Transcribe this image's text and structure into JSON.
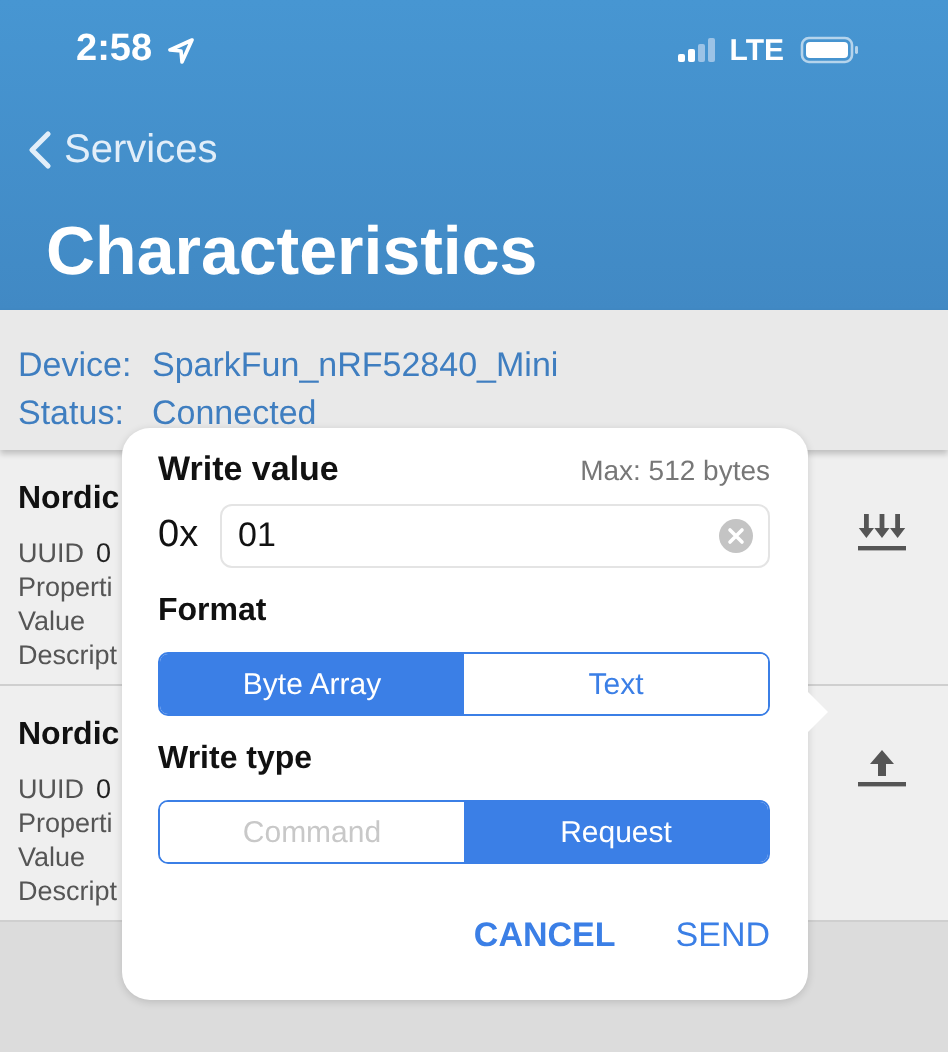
{
  "status_bar": {
    "time": "2:58",
    "network": "LTE"
  },
  "nav": {
    "back": "Services",
    "title": "Characteristics"
  },
  "device": {
    "device_label": "Device:",
    "device": "SparkFun_nRF52840_Mini",
    "status_label": "Status:",
    "status": "Connected"
  },
  "characteristics": [
    {
      "name": "Nordic",
      "uuid_label": "UUID",
      "uuid": "0",
      "properties_label": "Properti",
      "value_label": "Value",
      "descriptor_label": "Descript",
      "kind": "notify"
    },
    {
      "name": "Nordic",
      "uuid_label": "UUID",
      "uuid": "0",
      "properties_label": "Properti",
      "value_label": "Value",
      "descriptor_label": "Descript",
      "kind": "write"
    }
  ],
  "dialog": {
    "title": "Write value",
    "max": "Max: 512 bytes",
    "prefix": "0x",
    "value": "01",
    "format_label": "Format",
    "format_options": [
      {
        "label": "Byte Array",
        "selected": true,
        "disabled": false
      },
      {
        "label": "Text",
        "selected": false,
        "disabled": false
      }
    ],
    "write_type_label": "Write type",
    "write_type_options": [
      {
        "label": "Command",
        "selected": false,
        "disabled": true
      },
      {
        "label": "Request",
        "selected": true,
        "disabled": false
      }
    ],
    "buttons": [
      {
        "label": "CANCEL",
        "bold": true
      },
      {
        "label": "SEND",
        "bold": false
      }
    ]
  }
}
